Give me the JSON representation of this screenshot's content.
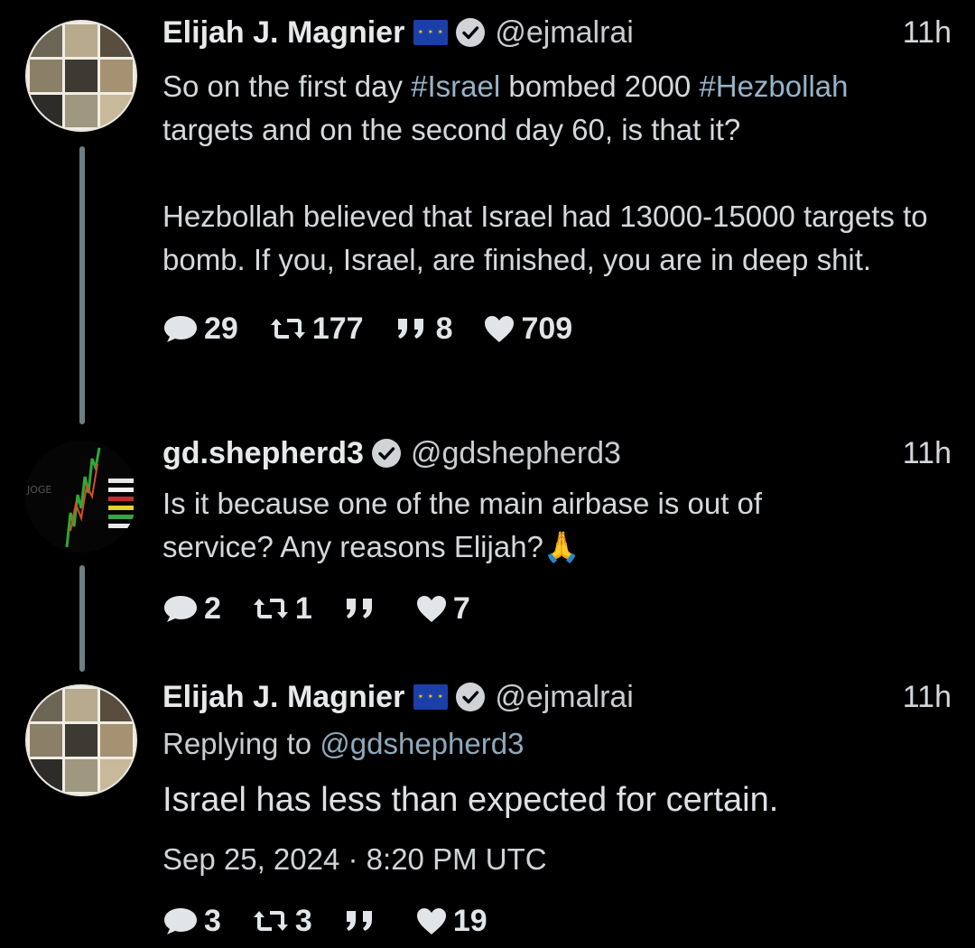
{
  "colors": {
    "background": "#000000",
    "text": "#d5d9dc",
    "hashtag": "#97b3c7",
    "thread_line": "#6c7f82",
    "verified_badge": "#d0d4d7"
  },
  "tweets": [
    {
      "author_name": "Elijah J. Magnier",
      "flag": "eu-flag-icon",
      "verified": true,
      "handle": "@ejmalrai",
      "time": "11h",
      "text_pre_1": "So on the first day ",
      "hashtag_1": "#Israel",
      "text_mid_1": " bombed 2000 ",
      "hashtag_2": "#Hezbollah",
      "text_post_1": "targets and on the second day 60, is that it?",
      "paragraph_2": "Hezbollah believed that Israel had 13000-15000 targets to bomb. If you, Israel, are finished, you are in deep shit.",
      "stats": {
        "replies": "29",
        "retweets": "177",
        "quotes": "8",
        "likes": "709"
      }
    },
    {
      "author_name": "gd.shepherd3",
      "verified": true,
      "handle": "@gdshepherd3",
      "time": "11h",
      "text": "Is it because one of the main airbase is out of service? Any reasons Elijah?🙏",
      "stats": {
        "replies": "2",
        "retweets": "1",
        "quotes": "",
        "likes": "7"
      }
    },
    {
      "author_name": "Elijah J. Magnier",
      "flag": "eu-flag-icon",
      "verified": true,
      "handle": "@ejmalrai",
      "time": "11h",
      "replying_label": "Replying to ",
      "replying_to": "@gdshepherd3",
      "text": "Israel has less than expected for certain.",
      "date": "Sep 25, 2024 · 8:20 PM UTC",
      "stats": {
        "replies": "3",
        "retweets": "3",
        "quotes": "",
        "likes": "19"
      }
    }
  ]
}
